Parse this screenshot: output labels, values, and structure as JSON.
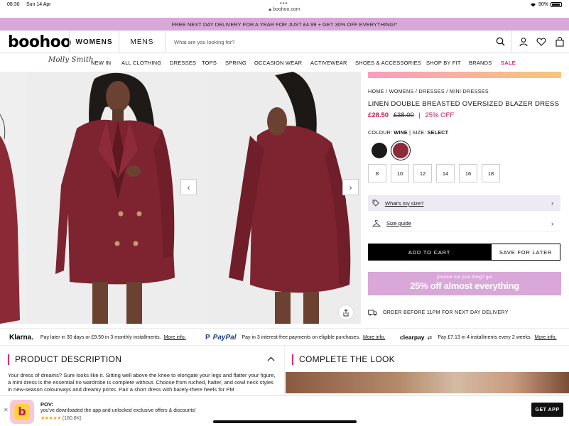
{
  "status": {
    "time": "08:30",
    "date": "Sun 14 Apr",
    "battery": "90%",
    "url": "boohoo.com"
  },
  "promo": {
    "text": "FREE NEXT DAY DELIVERY FOR A YEAR FOR JUST £4.99 + GET 30% OFF EVERYTHING!*"
  },
  "header": {
    "logo": "boohoo",
    "tabs": [
      {
        "label": "WOMENS"
      },
      {
        "label": "MENS"
      }
    ],
    "search_placeholder": "What are you looking for?"
  },
  "nav": {
    "signature": "Molly Smith",
    "items": [
      {
        "label": "NEW IN"
      },
      {
        "label": "ALL CLOTHING"
      },
      {
        "label": "DRESSES"
      },
      {
        "label": "TOPS"
      },
      {
        "label": "SPRING"
      },
      {
        "label": "OCCASION WEAR"
      },
      {
        "label": "ACTIVEWEAR"
      },
      {
        "label": "SHOES & ACCESSORIES"
      },
      {
        "label": "SHOP BY FIT"
      },
      {
        "label": "BRANDS"
      },
      {
        "label": "SALE"
      }
    ]
  },
  "product": {
    "breadcrumb": "HOME / WOMENS / DRESSES / MINI DRESSES",
    "title": "LINEN DOUBLE BREASTED OVERSIZED BLAZER DRESS",
    "price_now": "£28.50",
    "price_was": "£38.00",
    "price_sep": "|",
    "discount": "25% OFF",
    "colour_label": "COLOUR:",
    "colour_value": "WINE",
    "colour_sep": "|",
    "size_label": "SIZE:",
    "size_value": "SELECT",
    "sizes": [
      "8",
      "10",
      "12",
      "14",
      "16",
      "18"
    ],
    "whats_my_size": "What's my size?",
    "size_guide": "Size guide",
    "add_to_cart": "ADD TO CART",
    "save_for_later": "SAVE FOR LATER",
    "premier_small": "premier not your thing? get",
    "premier_big": "25% off almost everything",
    "delivery": "ORDER BEFORE 11PM FOR NEXT DAY DELIVERY"
  },
  "payments": {
    "klarna": {
      "logo": "Klarna.",
      "text": "Pay later in 30 days or £9.50 in 3 monthly installments.",
      "more": "More info."
    },
    "paypal": {
      "logo": "PayPal",
      "text": "Pay in 3 interest-free payments on eligible purchases.",
      "more": "More info."
    },
    "clearpay": {
      "logo": "clearpay",
      "text": "Pay £7.13 in 4 installments every 2 weeks.",
      "more": "More info."
    }
  },
  "sections": {
    "description_title": "PRODUCT DESCRIPTION",
    "description_text": "Your dress of dreams? Sure looks like it. Sitting well above the knee to elongate your legs and flatter your figure, a mini dress is the essential no wardrobe is complete without. Choose from ruched, halter, and cowl neck styles in new-season colourways and dreamy prints. Pair a short dress with barely-there heels for PM",
    "look_title": "COMPLETE THE LOOK"
  },
  "app_banner": {
    "title": "POV:",
    "subtitle": "you've downloaded the app and unlocked exclusive offers & discounts!",
    "stars": "★★★★★",
    "rating": "(180.8K)",
    "button": "GET APP",
    "close": "✕"
  }
}
